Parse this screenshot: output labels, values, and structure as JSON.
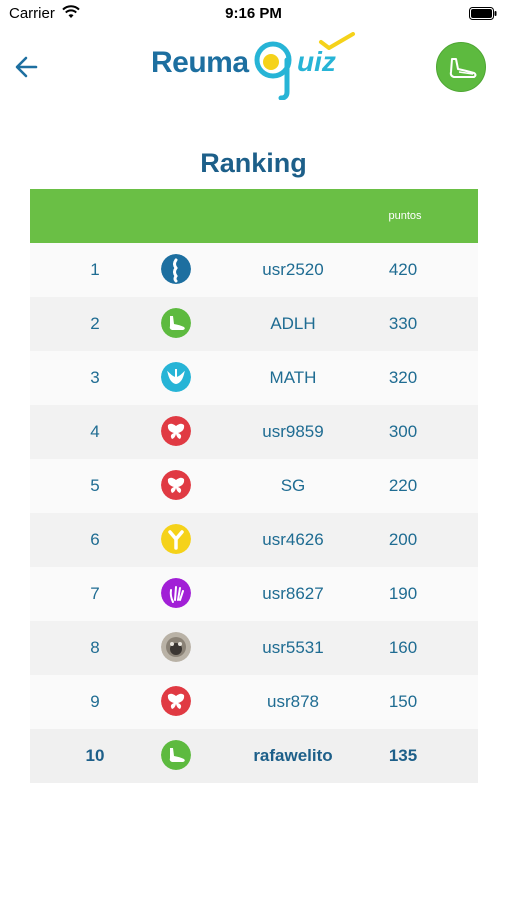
{
  "status_bar": {
    "carrier": "Carrier",
    "time": "9:16 PM"
  },
  "nav": {
    "logo_main": "Reuma",
    "logo_accent": "uiz"
  },
  "page_title": "Ranking",
  "table": {
    "columns": [
      "",
      "",
      "",
      "puntos"
    ],
    "rows": [
      {
        "rank": "1",
        "avatar_icon": "spine-icon",
        "avatar_color": "#1d6fa0",
        "name": "usr2520",
        "points": "420"
      },
      {
        "rank": "2",
        "avatar_icon": "foot-icon",
        "avatar_color": "#5dba3f",
        "name": "ADLH",
        "points": "330"
      },
      {
        "rank": "3",
        "avatar_icon": "pelvis-icon",
        "avatar_color": "#27b4d6",
        "name": "MATH",
        "points": "320"
      },
      {
        "rank": "4",
        "avatar_icon": "butterfly-icon",
        "avatar_color": "#e03a43",
        "name": "usr9859",
        "points": "300"
      },
      {
        "rank": "5",
        "avatar_icon": "butterfly-icon",
        "avatar_color": "#e03a43",
        "name": "SG",
        "points": "220"
      },
      {
        "rank": "6",
        "avatar_icon": "antibody-icon",
        "avatar_color": "#f5d21a",
        "name": "usr4626",
        "points": "200"
      },
      {
        "rank": "7",
        "avatar_icon": "hand-icon",
        "avatar_color": "#a11fd6",
        "name": "usr8627",
        "points": "190"
      },
      {
        "rank": "8",
        "avatar_icon": "pug-photo-icon",
        "avatar_color": "#b9b2a6",
        "name": "usr5531",
        "points": "160"
      },
      {
        "rank": "9",
        "avatar_icon": "butterfly-icon",
        "avatar_color": "#e03a43",
        "name": "usr878",
        "points": "150"
      },
      {
        "rank": "10",
        "avatar_icon": "foot-icon",
        "avatar_color": "#5dba3f",
        "name": "rafawelito",
        "points": "135"
      }
    ]
  },
  "colors": {
    "header_green": "#6abf45",
    "text_blue": "#1f6c92",
    "title_blue": "#1d5f89"
  }
}
